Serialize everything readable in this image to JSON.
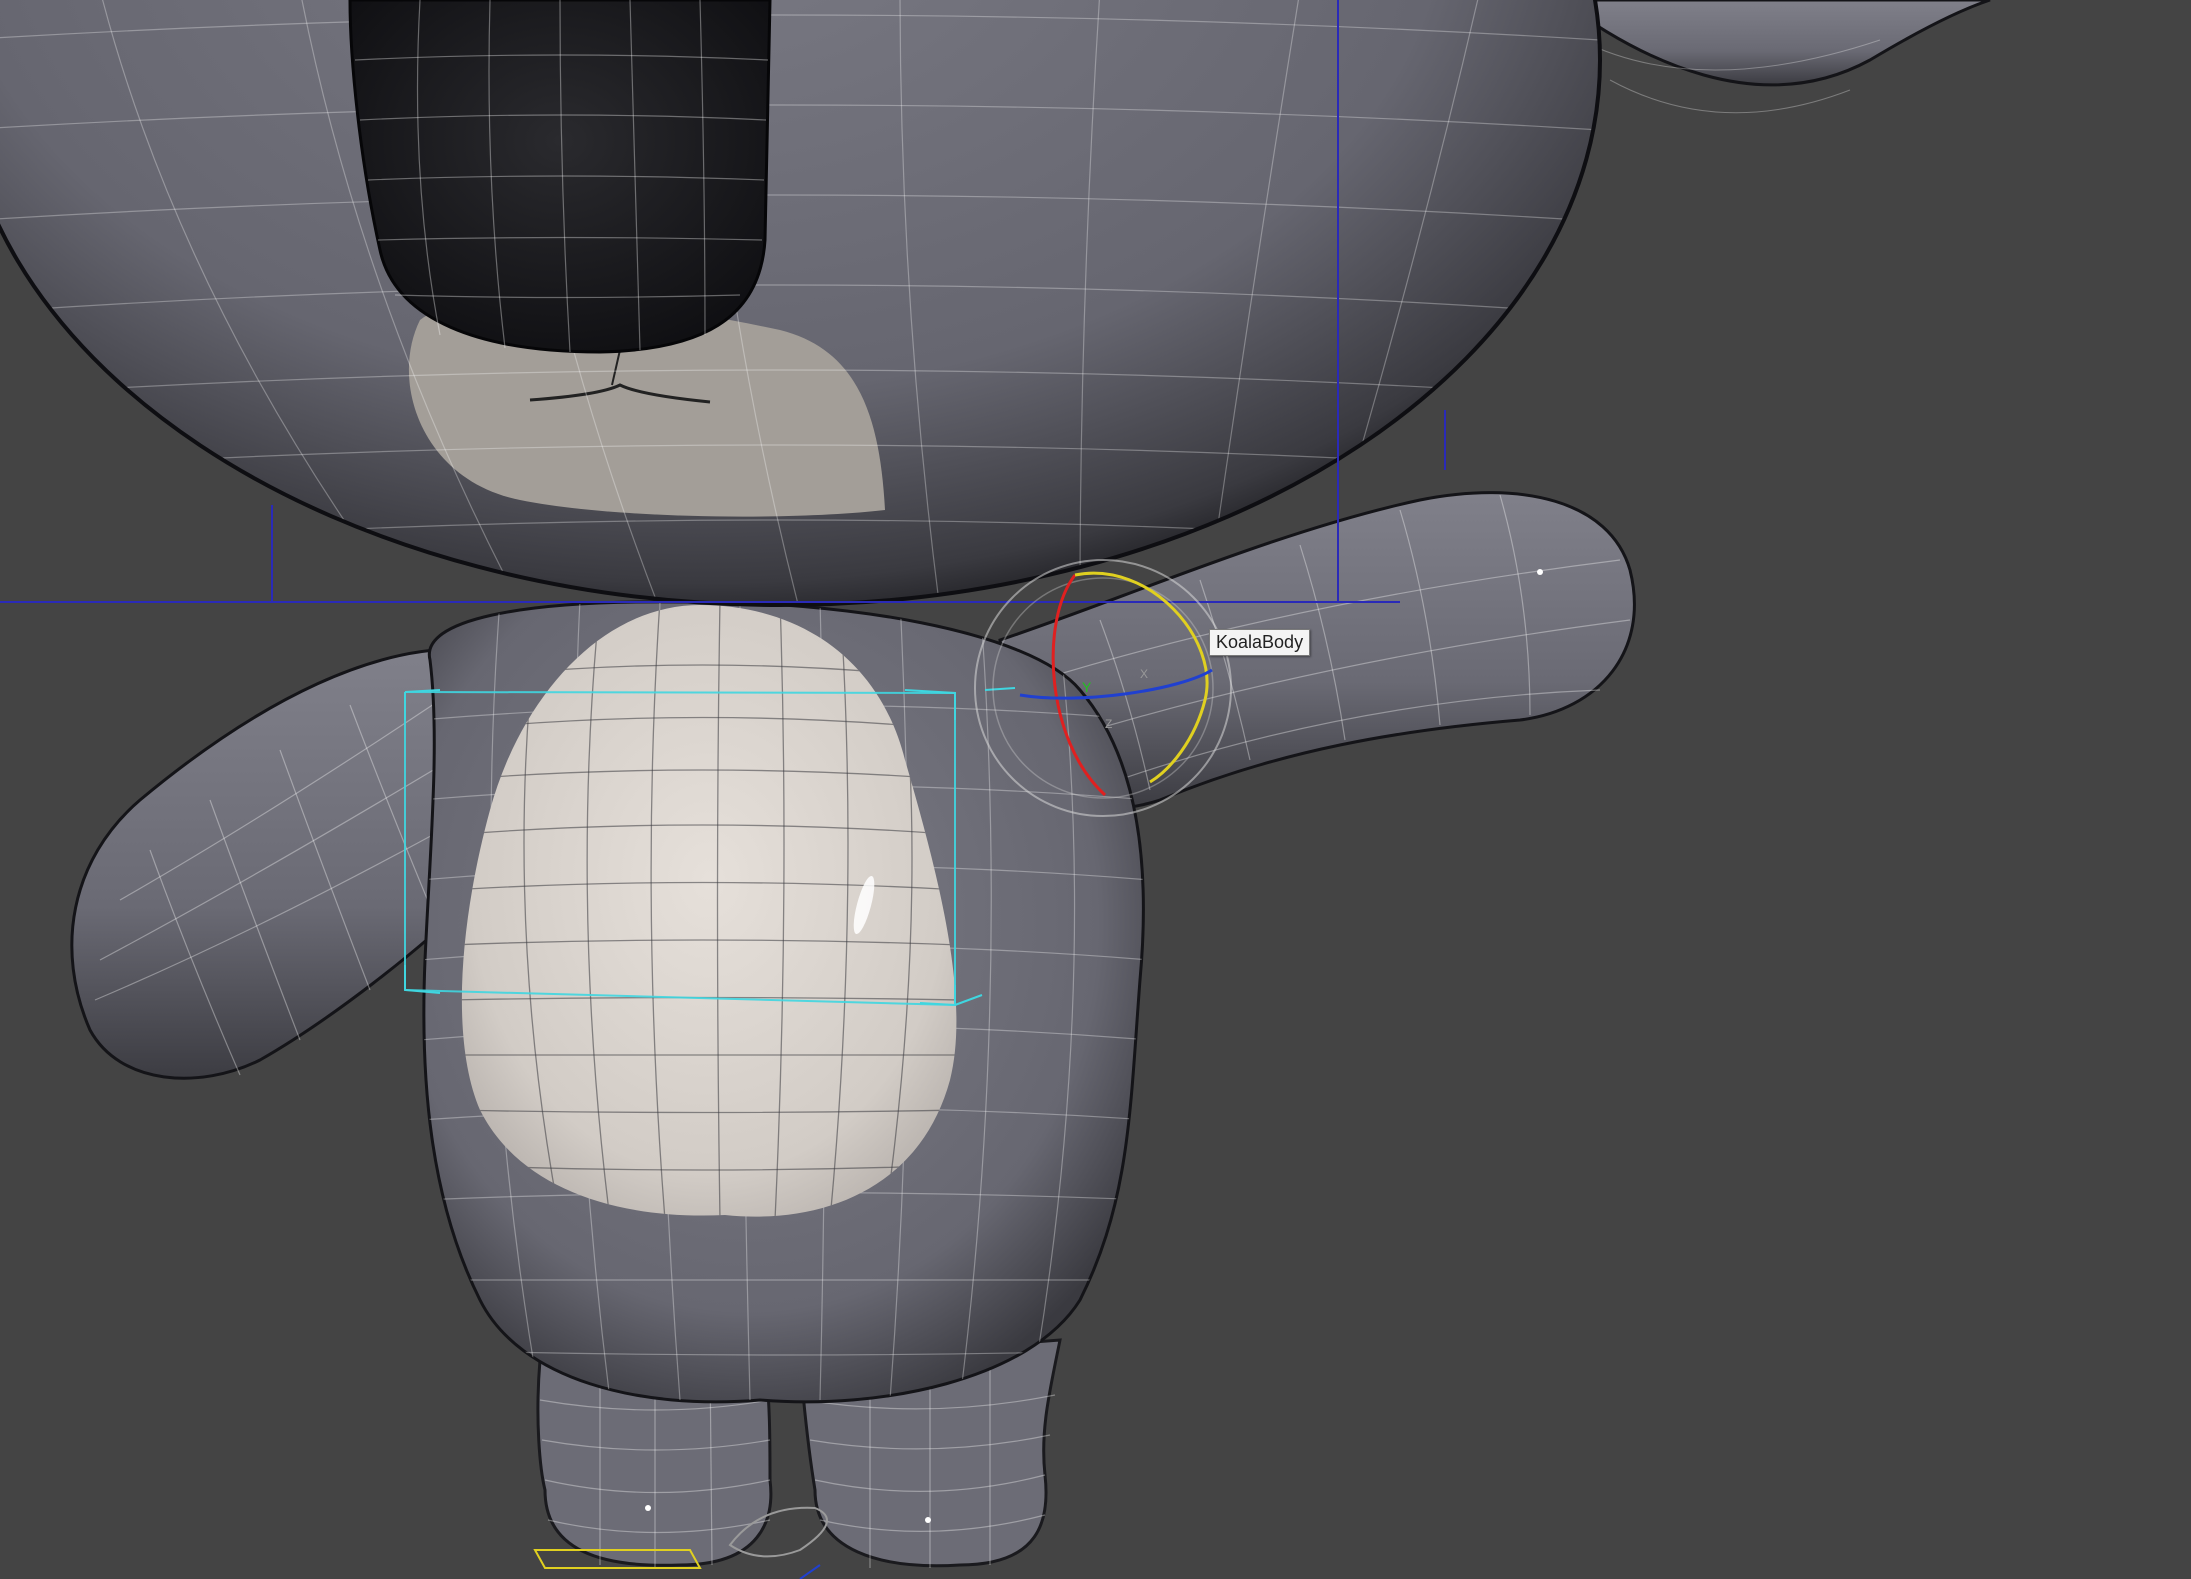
{
  "viewport": {
    "background": "#444444",
    "mesh_color": "#6e6e78",
    "belly_color": "#d8d2cc",
    "wireframe_color": "#ffffff",
    "bbox_color": "#3fd6e0",
    "gizmo_colors": {
      "x": "#e02020",
      "y": "#e0d020",
      "z": "#2040d0"
    }
  },
  "tooltip": {
    "label": "KoalaBody"
  },
  "gizmo": {
    "type": "rotate-gizmo",
    "axes": [
      "x",
      "y",
      "z"
    ]
  }
}
